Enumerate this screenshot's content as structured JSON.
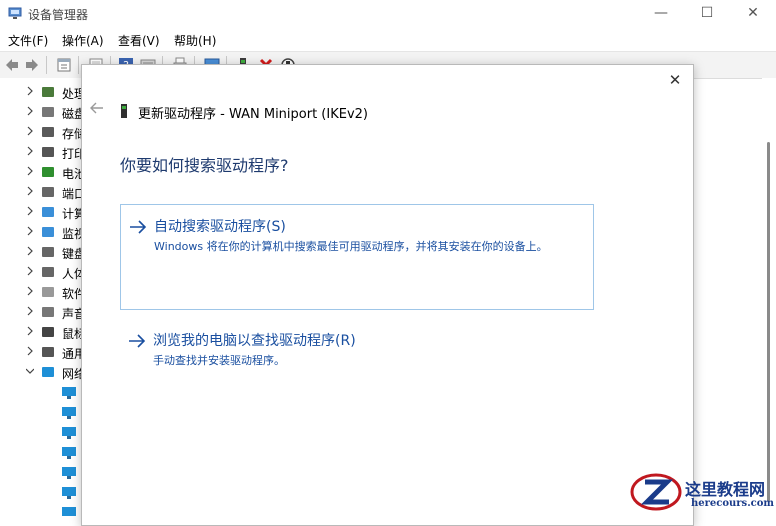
{
  "window": {
    "title": "设备管理器",
    "minimize_glyph": "—",
    "maximize_glyph": "☐",
    "close_glyph": "✕"
  },
  "menu": [
    {
      "label": "文件(F)"
    },
    {
      "label": "操作(A)"
    },
    {
      "label": "查看(V)"
    },
    {
      "label": "帮助(H)"
    }
  ],
  "toolbar_icons": [
    "back-arrow-icon",
    "forward-arrow-icon",
    "properties-icon",
    "refresh-icon",
    "help-icon",
    "view-icon",
    "print-icon",
    "monitor-icon",
    "update-driver-icon",
    "uninstall-icon",
    "scan-hardware-icon"
  ],
  "tree": {
    "categories": [
      {
        "label": "处理",
        "icon": "processor-icon"
      },
      {
        "label": "磁盘",
        "icon": "disk-drive-icon"
      },
      {
        "label": "存储",
        "icon": "storage-controller-icon"
      },
      {
        "label": "打印",
        "icon": "print-queue-icon"
      },
      {
        "label": "电池",
        "icon": "battery-icon"
      },
      {
        "label": "端口",
        "icon": "port-icon"
      },
      {
        "label": "计算",
        "icon": "computer-icon"
      },
      {
        "label": "监视",
        "icon": "monitor-icon"
      },
      {
        "label": "键盘",
        "icon": "keyboard-icon"
      },
      {
        "label": "人体",
        "icon": "hid-icon"
      },
      {
        "label": "软件",
        "icon": "software-device-icon"
      },
      {
        "label": "声音",
        "icon": "audio-icon"
      },
      {
        "label": "鼠标",
        "icon": "mouse-icon"
      },
      {
        "label": "通用",
        "icon": "usb-icon"
      },
      {
        "label": "网络",
        "icon": "network-adapter-icon",
        "expanded": true
      }
    ],
    "network_children_count_visible": 7
  },
  "dialog": {
    "close_glyph": "✕",
    "header": "更新驱动程序 - WAN Miniport (IKEv2)",
    "question": "你要如何搜索驱动程序?",
    "options": [
      {
        "title": "自动搜索驱动程序(S)",
        "description": "Windows 将在你的计算机中搜索最佳可用驱动程序，并将其安装在你的设备上。",
        "selected": true
      },
      {
        "title": "浏览我的电脑以查找驱动程序(R)",
        "description": "手动查找并安装驱动程序。",
        "selected": false
      }
    ]
  },
  "watermark": {
    "text": "这里教程网",
    "url": "herecours.com"
  },
  "colors": {
    "accent": "#1a4fa0",
    "question": "#1e3a6e",
    "selected_border": "#9fc6e8",
    "network_icon": "#1e8fd6"
  }
}
